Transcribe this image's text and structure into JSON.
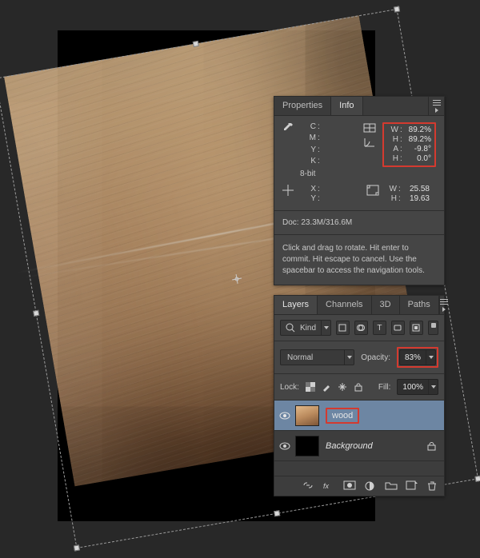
{
  "info_panel": {
    "tabs": {
      "properties": "Properties",
      "info": "Info"
    },
    "color_labels": {
      "c": "C",
      "m": "M",
      "y": "Y",
      "k": "K"
    },
    "transform_labels": {
      "w": "W",
      "h": "H",
      "a": "A",
      "hh": "H"
    },
    "transform_values": {
      "w": "89.2%",
      "h": "89.2%",
      "a": "-9.8°",
      "hh": "0.0°"
    },
    "bit_depth": "8-bit",
    "position_labels": {
      "x": "X",
      "y": "Y"
    },
    "doc_dim_labels": {
      "w": "W",
      "h": "H"
    },
    "doc_dim_values": {
      "w": "25.58",
      "h": "19.63"
    },
    "doc_text": "Doc: 23.3M/316.6M",
    "hint": "Click and drag to rotate. Hit enter to commit. Hit escape to cancel. Use the spacebar to access the navigation tools."
  },
  "layers_panel": {
    "tabs": {
      "layers": "Layers",
      "channels": "Channels",
      "threeD": "3D",
      "paths": "Paths"
    },
    "filter_kind": "Kind",
    "blend_mode": "Normal",
    "opacity_label": "Opacity:",
    "opacity_value": "83%",
    "lock_label": "Lock:",
    "fill_label": "Fill:",
    "fill_value": "100%",
    "layers": [
      {
        "name": "wood"
      },
      {
        "name": "Background"
      }
    ]
  }
}
